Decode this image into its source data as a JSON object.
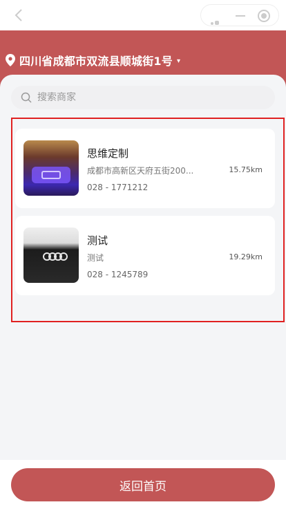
{
  "location": {
    "text": "四川省成都市双流县顺城街1号",
    "caret": "▾"
  },
  "search": {
    "placeholder": "搜索商家"
  },
  "stores": [
    {
      "name": "思维定制",
      "address": "成都市高新区天府五街200...",
      "distance": "15.75km",
      "phone": "028 - 1771212"
    },
    {
      "name": "测试",
      "address": "测试",
      "distance": "19.29km",
      "phone": "028 - 1245789"
    }
  ],
  "footer": {
    "home_label": "返回首页"
  },
  "icons": {
    "back": "chevron-left-icon",
    "location": "location-pin-icon",
    "search": "search-icon"
  },
  "colors": {
    "brand": "#c25656",
    "highlight": "#e02020"
  }
}
